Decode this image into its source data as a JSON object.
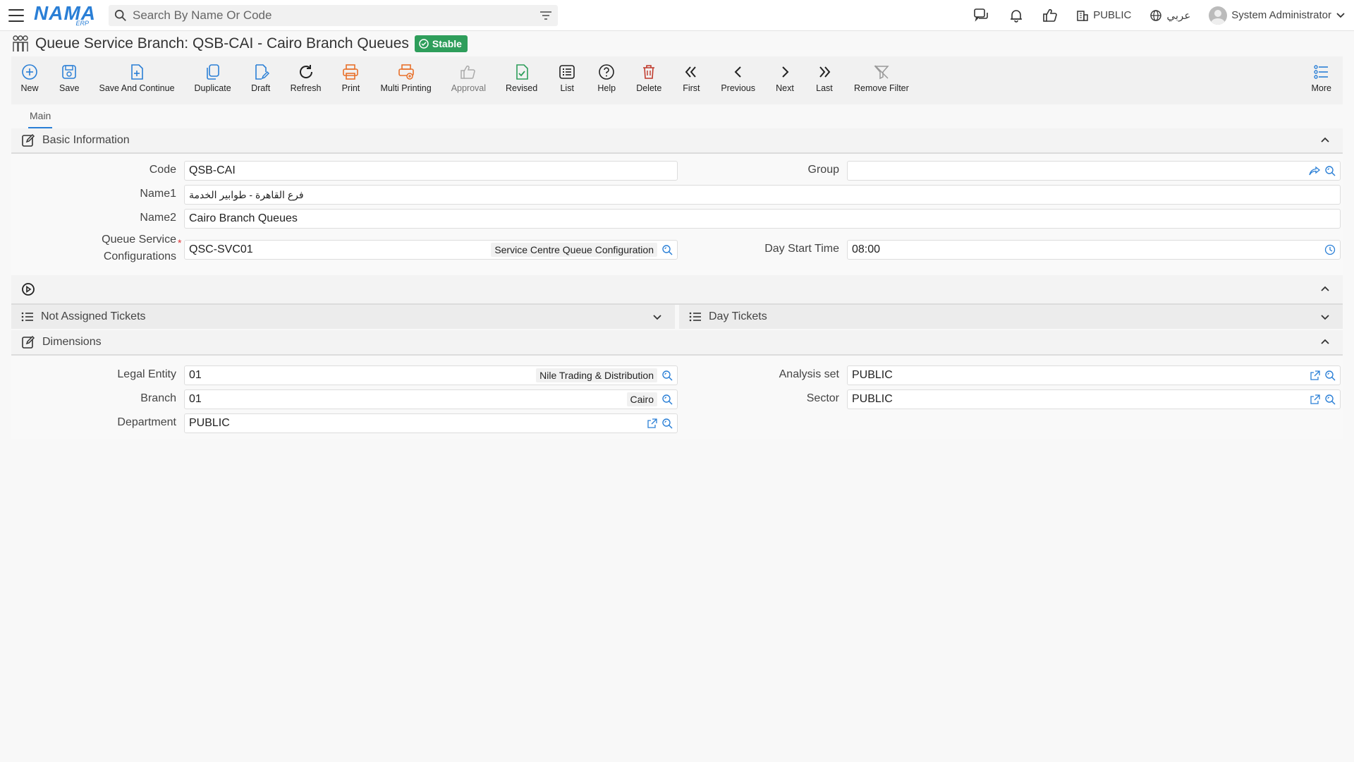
{
  "app": {
    "logo": "NAMA",
    "logo_sub": "ERP"
  },
  "search": {
    "placeholder": "Search By Name Or Code"
  },
  "topbar": {
    "company": "PUBLIC",
    "language": "عربي",
    "user": "System Administrator"
  },
  "page": {
    "title": "Queue Service Branch: QSB-CAI - Cairo Branch Queues",
    "status": "Stable"
  },
  "toolbar": {
    "new": "New",
    "save": "Save",
    "save_continue": "Save And Continue",
    "duplicate": "Duplicate",
    "draft": "Draft",
    "refresh": "Refresh",
    "print": "Print",
    "multi_printing": "Multi Printing",
    "approval": "Approval",
    "revised": "Revised",
    "list": "List",
    "help": "Help",
    "delete": "Delete",
    "first": "First",
    "previous": "Previous",
    "next": "Next",
    "last": "Last",
    "remove_filter": "Remove Filter",
    "more": "More"
  },
  "tabs": {
    "main": "Main"
  },
  "basic": {
    "title": "Basic Information",
    "code_label": "Code",
    "code": "QSB-CAI",
    "group_label": "Group",
    "group": "",
    "name1_label": "Name1",
    "name1": "فرع القاهرة - طوابير الخدمة",
    "name2_label": "Name2",
    "name2": "Cairo Branch Queues",
    "qsc_label_1": "Queue Service",
    "qsc_label_2": "Configurations",
    "qsc_code": "QSC-SVC01",
    "qsc_desc": "Service Centre Queue Configuration",
    "day_start_label": "Day Start Time",
    "day_start": "08:00"
  },
  "tickets": {
    "not_assigned": "Not Assigned Tickets",
    "day": "Day Tickets"
  },
  "dimensions": {
    "title": "Dimensions",
    "legal_entity_label": "Legal Entity",
    "legal_entity": "01",
    "legal_entity_desc": "Nile Trading & Distribution",
    "analysis_set_label": "Analysis set",
    "analysis_set": "PUBLIC",
    "branch_label": "Branch",
    "branch": "01",
    "branch_desc": "Cairo",
    "sector_label": "Sector",
    "sector": "PUBLIC",
    "department_label": "Department",
    "department": "PUBLIC"
  }
}
